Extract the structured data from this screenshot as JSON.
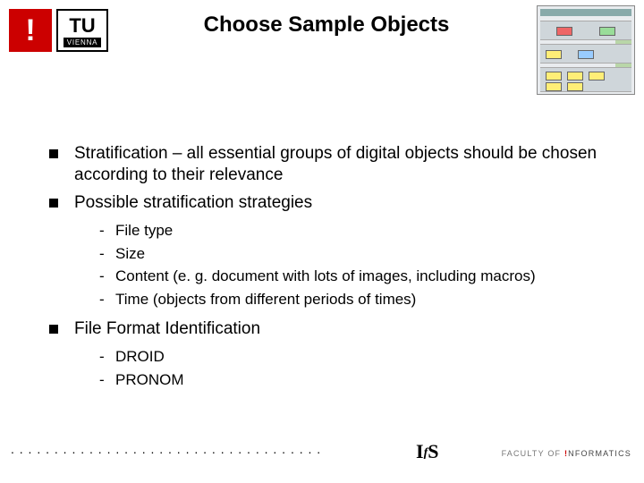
{
  "header": {
    "bang_label": "!",
    "tu_label": "TU",
    "tu_sub": "VIENNA",
    "title": "Choose Sample Objects"
  },
  "bullets": {
    "b0": "Stratification – all essential groups of digital objects should be chosen according to their relevance",
    "b1": "Possible stratification strategies",
    "b1_sub": {
      "s0": "File type",
      "s1": "Size",
      "s2": "Content (e. g. document with lots of images, including macros)",
      "s3": "Time (objects from different periods of times)"
    },
    "b2": "File Format Identification",
    "b2_sub": {
      "s0": "DROID",
      "s1": "PRONOM"
    }
  },
  "footer": {
    "dots": ". . . . . . . . . . . . . . . . . . . . . . . . . . . . . . . . . . . . . . . . . . . . . . .",
    "ifs_i": "I",
    "ifs_f": "f",
    "ifs_s": "S",
    "faculty_pre": "FACULTY OF ",
    "faculty_bang": "!",
    "faculty_word": "NFORMATICS"
  }
}
